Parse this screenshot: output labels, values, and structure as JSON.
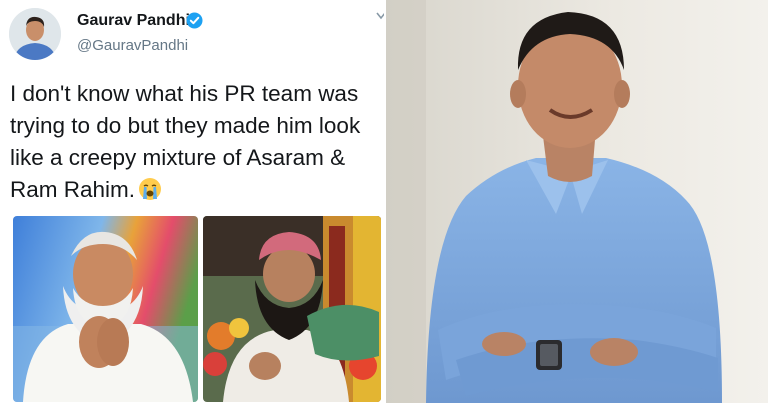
{
  "tweet": {
    "display_name": "Gaurav Pandhi",
    "handle": "@GauravPandhi",
    "verified": true,
    "text": "I don't know what his PR team was trying to do but they made him look like a creepy mixture of Asaram & Ram Rahim.",
    "emoji_icon": "loudly-crying-face-icon",
    "media": [
      {
        "kind": "photo",
        "subject": "elderly man with white beard in white robe, hands folded"
      },
      {
        "kind": "photo",
        "subject": "bearded man in white turban on stage with flowers"
      }
    ]
  },
  "photo_panel": {
    "subject": "smiling man in blue shirt with arms crossed"
  },
  "colors": {
    "text": "#14171a",
    "handle": "#657786",
    "verified_badge": "#1da1f2",
    "shirt_blue": "#7fa9dd",
    "wall": "#e9e6df"
  }
}
